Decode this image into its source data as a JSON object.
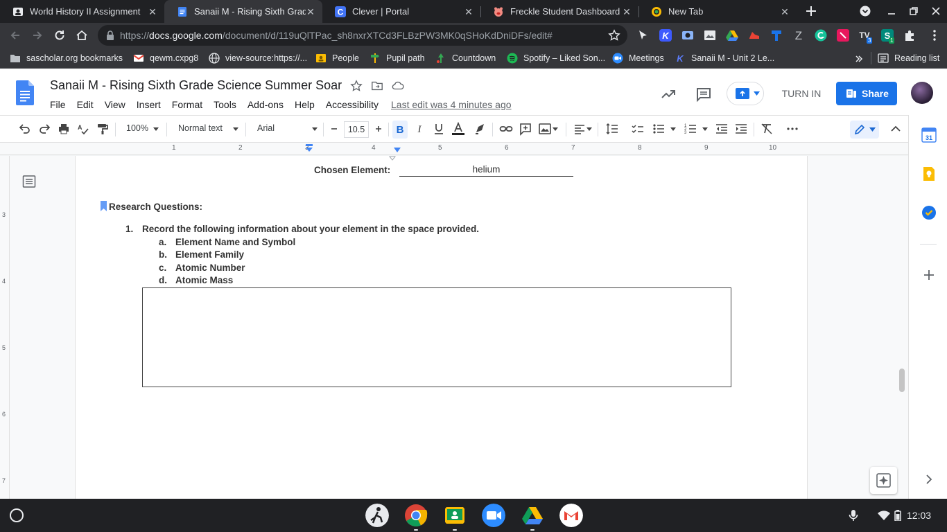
{
  "browser": {
    "tabs": [
      {
        "label": "World History II Assignment",
        "active": false
      },
      {
        "label": "Sanaii M - Rising Sixth Grade Science Summer Soar",
        "active": true
      },
      {
        "label": "Clever | Portal",
        "active": false
      },
      {
        "label": "Freckle Student Dashboard",
        "active": false
      },
      {
        "label": "New Tab",
        "active": false
      }
    ],
    "url_prefix": "https://",
    "url_host": "docs.google.com",
    "url_path": "/document/d/119uQlTPac_sh8nxrXTCd3FLBzPW3MK0qSHoKdDniDFs/edit#",
    "reading_list": "Reading list",
    "bookmarks": [
      "sascholar.org bookmarks",
      "qewm.cxpg8",
      "view-source:https://...",
      "People",
      "Pupil path",
      "Countdown",
      "Spotify – Liked Son...",
      "Meetings",
      "Sanaii M - Unit 2 Le..."
    ],
    "ext_badges": {
      "tv": "3",
      "s": "1"
    }
  },
  "docs": {
    "title": "Sanaii M - Rising Sixth Grade Science Summer Soar",
    "menu": [
      "File",
      "Edit",
      "View",
      "Insert",
      "Format",
      "Tools",
      "Add-ons",
      "Help",
      "Accessibility"
    ],
    "last_edit": "Last edit was 4 minutes ago",
    "turn_in": "TURN IN",
    "share": "Share"
  },
  "toolbar": {
    "zoom": "100%",
    "style": "Normal text",
    "font": "Arial",
    "font_size": "10.5"
  },
  "ruler": [
    "1",
    "2",
    "3",
    "4",
    "5",
    "6",
    "7",
    "8",
    "9",
    "10"
  ],
  "vruler": [
    "3",
    "4",
    "5",
    "6",
    "7"
  ],
  "document": {
    "chosen_label": "Chosen Element:",
    "chosen_value": "helium",
    "research_heading": "Research Questions:",
    "q1_num": "1.",
    "q1_text": "Record the following information about your element in the space provided.",
    "items": [
      {
        "letter": "a.",
        "text": "Element Name and Symbol"
      },
      {
        "letter": "b.",
        "text": "Element Family"
      },
      {
        "letter": "c.",
        "text": "Atomic Number"
      },
      {
        "letter": "d.",
        "text": "Atomic Mass"
      }
    ]
  },
  "shelf": {
    "time": "12:03"
  },
  "colors": {
    "accent": "#1a73e8",
    "docs_blue": "#4285f4"
  }
}
